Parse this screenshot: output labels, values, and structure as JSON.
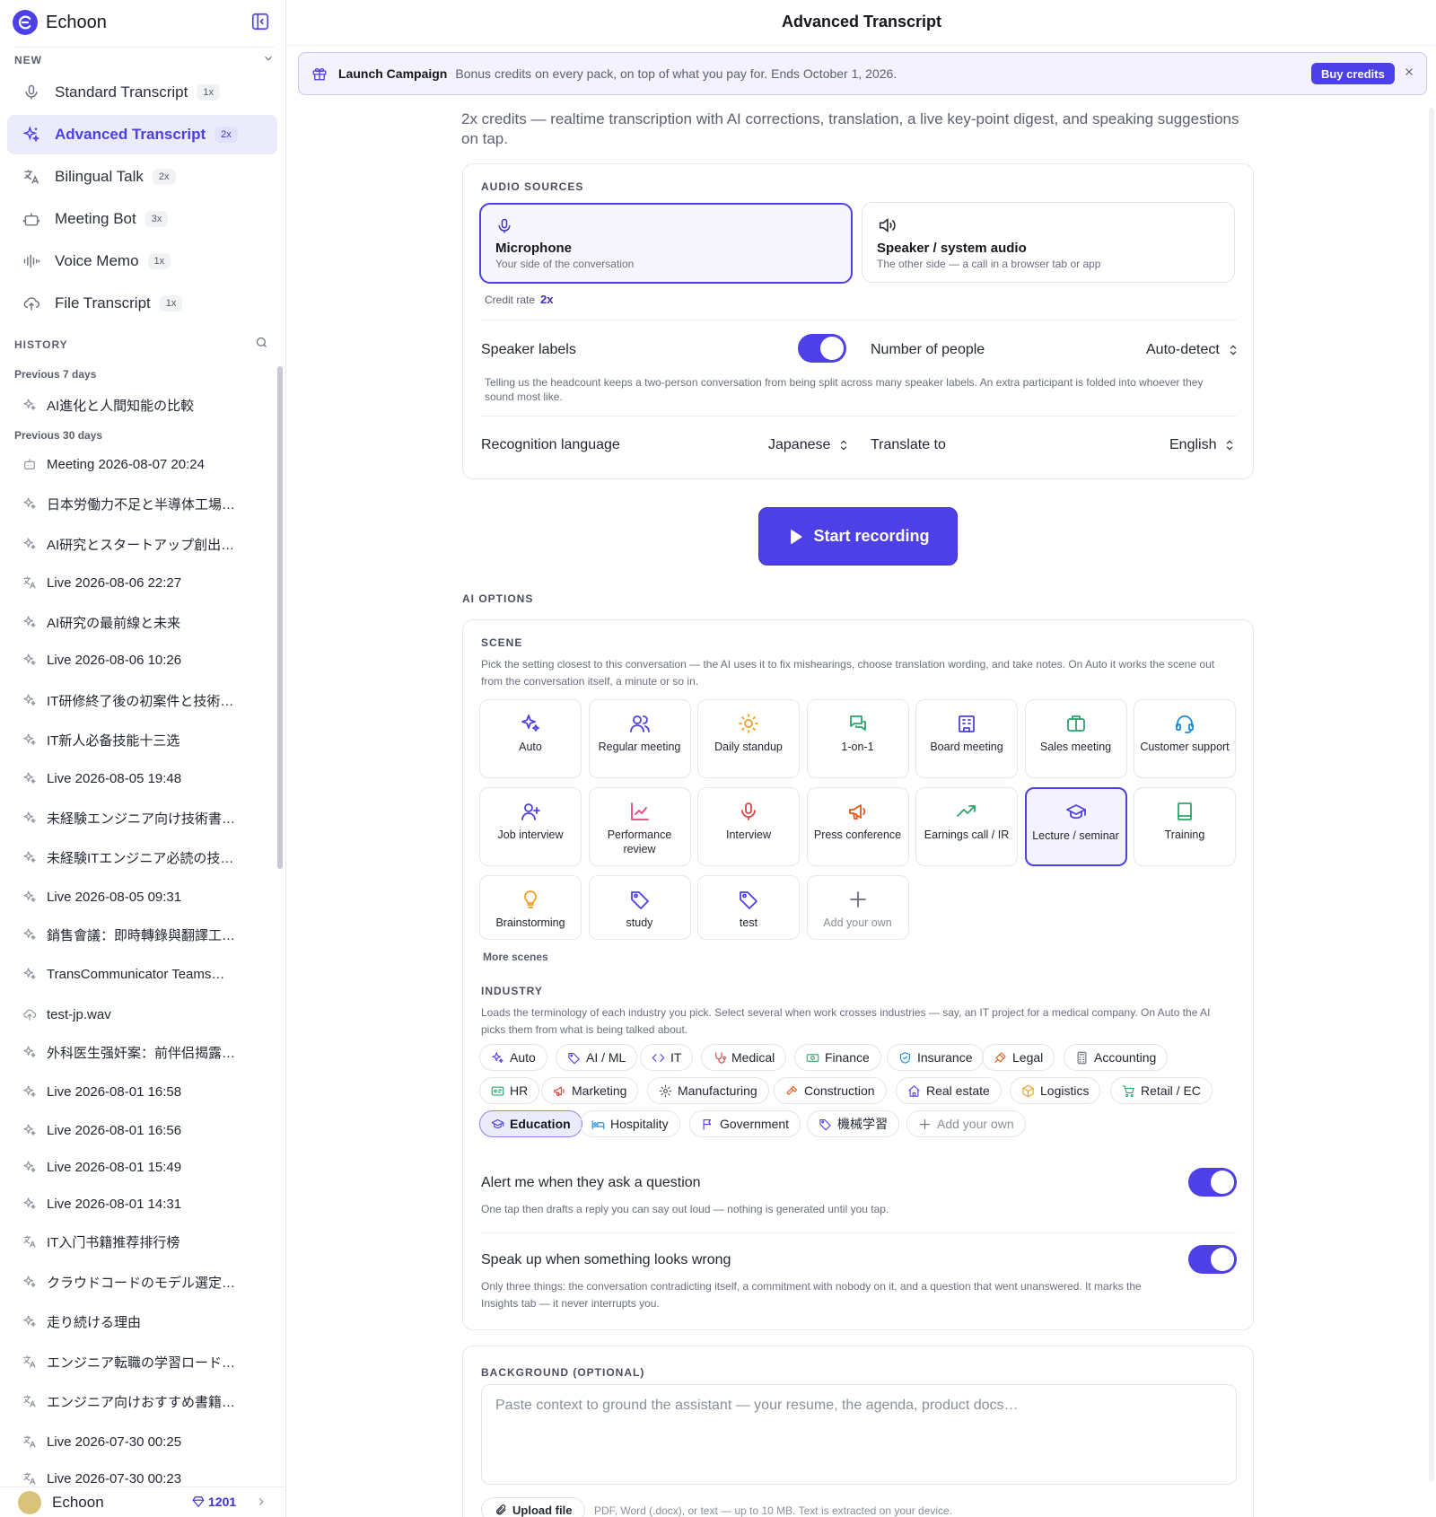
{
  "app": {
    "name": "Echoon",
    "page_title": "Advanced Transcript"
  },
  "sidebar": {
    "new_label": "NEW",
    "nav": [
      {
        "label": "Standard Transcript",
        "badge": "1x",
        "icon": "mic-icon",
        "active": false
      },
      {
        "label": "Advanced Transcript",
        "badge": "2x",
        "icon": "sparkles-icon",
        "active": true
      },
      {
        "label": "Bilingual Talk",
        "badge": "2x",
        "icon": "translate-icon",
        "active": false
      },
      {
        "label": "Meeting Bot",
        "badge": "3x",
        "icon": "bot-icon",
        "active": false
      },
      {
        "label": "Voice Memo",
        "badge": "1x",
        "icon": "waveform-icon",
        "active": false
      },
      {
        "label": "File Transcript",
        "badge": "1x",
        "icon": "cloud-upload-icon",
        "active": false
      }
    ],
    "history_label": "HISTORY",
    "groups": [
      {
        "label": "Previous 7 days",
        "items": [
          {
            "title": "AI進化と人間知能の比較",
            "icon": "sparkles"
          }
        ]
      },
      {
        "label": "Previous 30 days",
        "items": [
          {
            "title": "Meeting 2026-08-07 20:24",
            "icon": "bot"
          },
          {
            "title": "日本労働力不足と半導体工場…",
            "icon": "sparkles"
          },
          {
            "title": "AI研究とスタートアップ創出…",
            "icon": "sparkles"
          },
          {
            "title": "Live 2026-08-06 22:27",
            "icon": "translate"
          },
          {
            "title": "AI研究の最前線と未来",
            "icon": "sparkles"
          },
          {
            "title": "Live 2026-08-06 10:26",
            "icon": "sparkles"
          },
          {
            "title": "IT研修終了後の初案件と技術…",
            "icon": "sparkles"
          },
          {
            "title": "IT新人必备技能十三选",
            "icon": "sparkles"
          },
          {
            "title": "Live 2026-08-05 19:48",
            "icon": "sparkles"
          },
          {
            "title": "未経験エンジニア向け技術書…",
            "icon": "sparkles"
          },
          {
            "title": "未経験ITエンジニア必読の技…",
            "icon": "sparkles"
          },
          {
            "title": "Live 2026-08-05 09:31",
            "icon": "sparkles"
          },
          {
            "title": "銷售會議：即時轉錄與翻譯工…",
            "icon": "sparkles"
          },
          {
            "title": "TransCommunicator Teams…",
            "icon": "sparkles"
          },
          {
            "title": "test-jp.wav",
            "icon": "cloud"
          },
          {
            "title": "外科医生强奸案：前伴侣揭露…",
            "icon": "sparkles"
          },
          {
            "title": "Live 2026-08-01 16:58",
            "icon": "sparkles"
          },
          {
            "title": "Live 2026-08-01 16:56",
            "icon": "sparkles"
          },
          {
            "title": "Live 2026-08-01 15:49",
            "icon": "sparkles"
          },
          {
            "title": "Live 2026-08-01 14:31",
            "icon": "sparkles"
          },
          {
            "title": "IT入门书籍推荐排行榜",
            "icon": "translate"
          },
          {
            "title": "クラウドコードのモデル選定…",
            "icon": "sparkles"
          },
          {
            "title": "走り続ける理由",
            "icon": "sparkles"
          },
          {
            "title": "エンジニア転職の学習ロード…",
            "icon": "translate"
          },
          {
            "title": "エンジニア向けおすすめ書籍…",
            "icon": "translate"
          },
          {
            "title": "Live 2026-07-30 00:25",
            "icon": "translate"
          },
          {
            "title": "Live 2026-07-30 00:23",
            "icon": "translate"
          }
        ]
      }
    ],
    "footer": {
      "name": "Echoon",
      "credits": "1201"
    }
  },
  "banner": {
    "title": "Launch Campaign",
    "text": "Bonus credits on every pack, on top of what you pay for. Ends October 1, 2026.",
    "button": "Buy credits"
  },
  "subtitle": "2x credits — realtime transcription with AI corrections, translation, a live key-point digest, and speaking suggestions on tap.",
  "audio": {
    "label": "AUDIO SOURCES",
    "sources": [
      {
        "title": "Microphone",
        "desc": "Your side of the conversation",
        "selected": true
      },
      {
        "title": "Speaker / system audio",
        "desc": "The other side — a call in a browser tab or app",
        "selected": false
      }
    ],
    "credit_rate_label": "Credit rate",
    "credit_rate": "2x",
    "speaker_labels": "Speaker labels",
    "speaker_labels_on": true,
    "people_label": "Number of people",
    "people_value": "Auto-detect",
    "people_help": "Telling us the headcount keeps a two-person conversation from being split across many speaker labels. An extra participant is folded into whoever they sound most like.",
    "recognition_label": "Recognition language",
    "recognition_value": "Japanese",
    "translate_label": "Translate to",
    "translate_value": "English"
  },
  "start_button": "Start recording",
  "ai_options": {
    "label": "AI OPTIONS",
    "scene_label": "SCENE",
    "scene_desc": "Pick the setting closest to this conversation — the AI uses it to fix mishearings, choose translation wording, and take notes. On Auto it works the scene out from the conversation itself, a minute or so in.",
    "scenes": [
      {
        "label": "Auto",
        "icon": "sparkles-icon",
        "color": "#4c40e6"
      },
      {
        "label": "Regular meeting",
        "icon": "users-icon",
        "color": "#4c40e6"
      },
      {
        "label": "Daily standup",
        "icon": "sun-icon",
        "color": "#f0a020"
      },
      {
        "label": "1-on-1",
        "icon": "chat-icon",
        "color": "#2ea36b"
      },
      {
        "label": "Board meeting",
        "icon": "building-icon",
        "color": "#4c40e6"
      },
      {
        "label": "Sales meeting",
        "icon": "briefcase-icon",
        "color": "#2ea36b"
      },
      {
        "label": "Customer support",
        "icon": "headset-icon",
        "color": "#1a8ad6"
      },
      {
        "label": "Job interview",
        "icon": "user-plus-icon",
        "color": "#4c40e6"
      },
      {
        "label": "Performance review",
        "icon": "chart-icon",
        "color": "#e0457b"
      },
      {
        "label": "Interview",
        "icon": "mic-icon",
        "color": "#e04040"
      },
      {
        "label": "Press conference",
        "icon": "megaphone-icon",
        "color": "#e05a1a"
      },
      {
        "label": "Earnings call / IR",
        "icon": "trend-icon",
        "color": "#2ea36b"
      },
      {
        "label": "Lecture / seminar",
        "icon": "cap-icon",
        "color": "#4c40e6",
        "selected": true
      },
      {
        "label": "Training",
        "icon": "book-icon",
        "color": "#2ea36b"
      },
      {
        "label": "Brainstorming",
        "icon": "bulb-icon",
        "color": "#f0a020"
      },
      {
        "label": "study",
        "icon": "tag-icon",
        "color": "#4c40e6"
      },
      {
        "label": "test",
        "icon": "tag-icon",
        "color": "#4c40e6"
      },
      {
        "label": "Add your own",
        "icon": "plus-icon",
        "color": "#6a6f7e",
        "add": true
      }
    ],
    "more_scenes": "More scenes",
    "industry_label": "INDUSTRY",
    "industry_desc": "Loads the terminology of each industry you pick. Select several when work crosses industries — say, an IT project for a medical company. On Auto the AI picks them from what is being talked about.",
    "industries": [
      {
        "label": "Auto",
        "icon": "sparkles",
        "color": "#4c40e6"
      },
      {
        "label": "AI / ML",
        "icon": "tag",
        "color": "#4c40e6"
      },
      {
        "label": "IT",
        "icon": "code",
        "color": "#4c40e6"
      },
      {
        "label": "Medical",
        "icon": "stetho",
        "color": "#e04040"
      },
      {
        "label": "Finance",
        "icon": "money",
        "color": "#2ea36b"
      },
      {
        "label": "Insurance",
        "icon": "shield",
        "color": "#1a8ad6"
      },
      {
        "label": "Legal",
        "icon": "gavel",
        "color": "#e05a1a"
      },
      {
        "label": "Accounting",
        "icon": "calc",
        "color": "#6a6f7e"
      },
      {
        "label": "HR",
        "icon": "idcard",
        "color": "#2ea36b"
      },
      {
        "label": "Marketing",
        "icon": "megaphone",
        "color": "#e04040"
      },
      {
        "label": "Manufacturing",
        "icon": "gear",
        "color": "#4a4f5e"
      },
      {
        "label": "Construction",
        "icon": "hammer",
        "color": "#e05a1a"
      },
      {
        "label": "Real estate",
        "icon": "home",
        "color": "#4c40e6"
      },
      {
        "label": "Logistics",
        "icon": "box",
        "color": "#f0a020"
      },
      {
        "label": "Retail / EC",
        "icon": "cart",
        "color": "#2ea36b"
      },
      {
        "label": "Education",
        "icon": "cap",
        "color": "#4c40e6",
        "selected": true
      },
      {
        "label": "Hospitality",
        "icon": "bed",
        "color": "#1a8ad6"
      },
      {
        "label": "Government",
        "icon": "flag",
        "color": "#4c40e6"
      },
      {
        "label": "機械学習",
        "icon": "tag",
        "color": "#4c40e6"
      },
      {
        "label": "Add your own",
        "icon": "plus",
        "color": "#6a6f7e",
        "add": true
      }
    ],
    "alert_title": "Alert me when they ask a question",
    "alert_desc": "One tap then drafts a reply you can say out loud — nothing is generated until you tap.",
    "alert_on": true,
    "speakup_title": "Speak up when something looks wrong",
    "speakup_desc": "Only three things: the conversation contradicting itself, a commitment with nobody on it, and a question that went unanswered. It marks the Insights tab — it never interrupts you.",
    "speakup_on": true
  },
  "background": {
    "label": "BACKGROUND (OPTIONAL)",
    "placeholder": "Paste context to ground the assistant — your resume, the agenda, product docs…",
    "upload": "Upload file",
    "upload_hint": "PDF, Word (.docx), or text — up to 10 MB. Text is extracted on your device."
  }
}
